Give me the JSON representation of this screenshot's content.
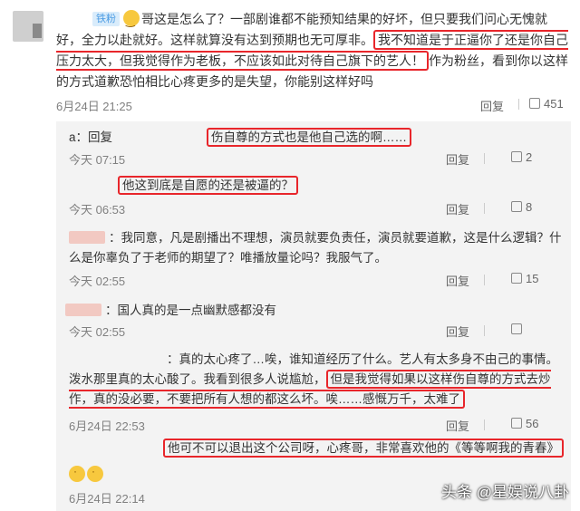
{
  "main": {
    "badge": "铁粉",
    "text_before_hl1": "哥这是怎么了？一部剧谁都不能预知结果的好坏，但只要我们问心无愧就好，全力以赴就好。这样就算没有达到预期也无可厚非。",
    "hl1": "我不知道是于正逼你了还是你自己压力太大，但我觉得作为老板，不应该如此对待自己旗下的艺人！",
    "text_after_hl1": "作为粉丝，看到你以这样的方式道歉恐怕相比心疼更多的是失望，你能别这样好吗",
    "date": "6月24日 21:25",
    "reply_label": "回复",
    "like_count": "451"
  },
  "replies": [
    {
      "prefix": "a：回复",
      "hl": "伤自尊的方式也是他自己选的啊……",
      "date": "今天 07:15",
      "reply_label": "回复",
      "like_count": "2"
    },
    {
      "hl": "他这到底是自愿的还是被逼的？",
      "date": "今天 06:53",
      "reply_label": "回复",
      "like_count": "8"
    },
    {
      "text": "：我同意，凡是剧播出不理想，演员就要负责任，演员就要道歉，这是什么逻辑？什么是你辜负了于老师的期望了？唯播放量论吗？我服气了。",
      "date": "今天 02:55",
      "reply_label": "回复",
      "like_count": "15"
    },
    {
      "text": "：国人真的是一点幽默感都没有",
      "date": "今天 02:55",
      "reply_label": "回复",
      "like_count": ""
    },
    {
      "text_before_hl1": "：真的太心疼了…唉，谁知道经历了什么。艺人有太多身不由己的事情。泼水那里真的太心酸了。我看到很多人说尴尬，",
      "hl1": "但是我觉得如果以这样伤自尊的方式去炒作，真的没必要，不要把所有人想的都这么坏。唉……感慨万千，太难了",
      "date": "6月24日 22:53",
      "reply_label": "回复",
      "like_count": "56"
    },
    {
      "hl": "他可不可以退出这个公司呀，心疼哥，非常喜欢他的《等等啊我的青春》",
      "date": "6月24日 22:14",
      "reply_label": "回复",
      "like_count": ""
    }
  ],
  "watermark": "头条 @星娱说八卦",
  "colors": {
    "highlight": "#e8262b",
    "reply_bg": "#f3f3f3",
    "meta_gray": "#808080"
  }
}
